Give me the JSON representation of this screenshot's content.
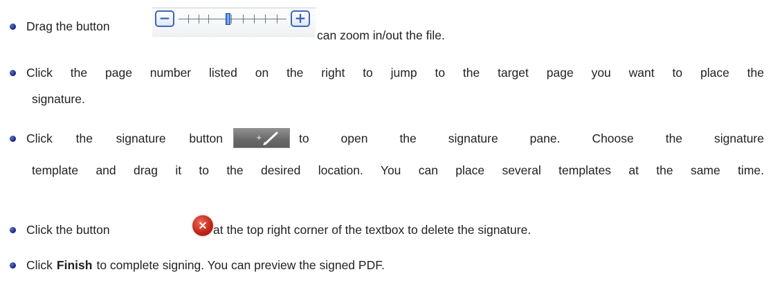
{
  "instructions": [
    {
      "before": "Drag the button",
      "after": "can zoom in/out the file.",
      "control": {
        "icon": "zoom-slider",
        "minus": "−",
        "plus": "+",
        "thumb_position": 0.46
      }
    },
    {
      "line1": "Click the page number listed on the right to jump to the target page you want to place the",
      "line2": "signature."
    },
    {
      "before": "Click the signature button",
      "after": "to open the signature pane. Choose the signature",
      "line2": "template and drag it to the desired location. You can place several templates at the same time.",
      "control": {
        "icon": "add-signature-button",
        "plus": "+"
      }
    },
    {
      "before": "Click the button",
      "after": "at the top right corner of the textbox to delete the signature.",
      "control": {
        "icon": "delete-icon",
        "glyph": "×"
      }
    },
    {
      "before": "Click",
      "bold": "Finish",
      "after": "to complete signing. You can preview the signed PDF."
    }
  ],
  "colors": {
    "text": "#222222",
    "bullet": "#15217a",
    "zoom_accent": "#3d66b8",
    "signature_button": "#6c6c6c",
    "delete_red": "#c3271c"
  }
}
